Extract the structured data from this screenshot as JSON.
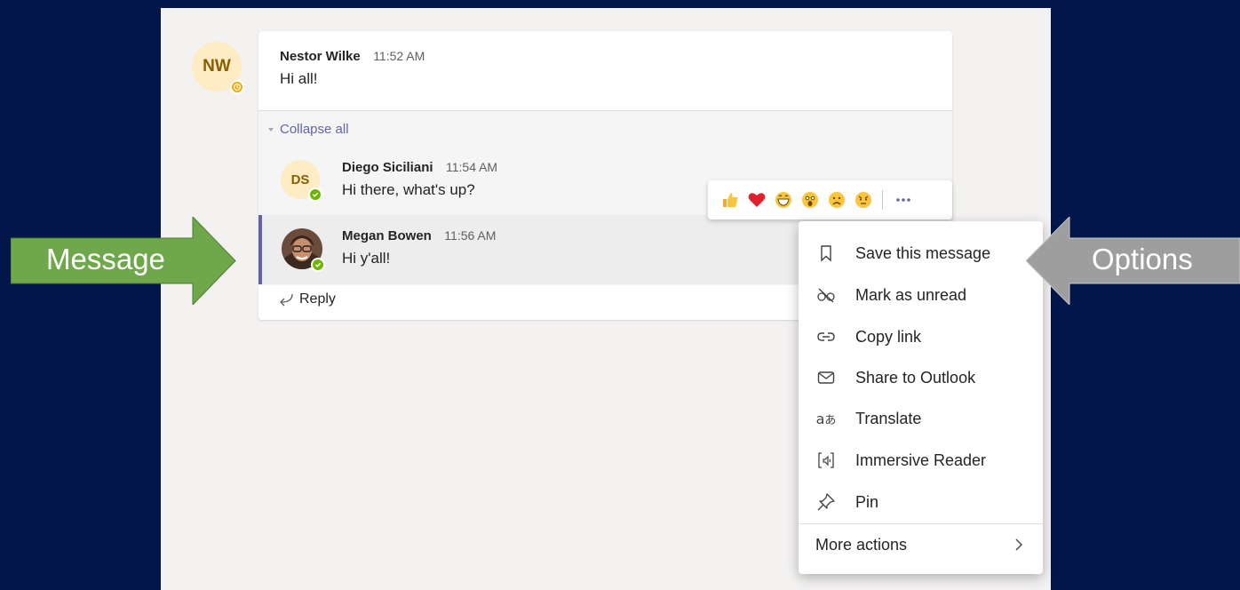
{
  "thread": {
    "root": {
      "avatar_initials": "NW",
      "author": "Nestor Wilke",
      "time": "11:52 AM",
      "text": "Hi all!",
      "status": "away"
    },
    "collapse_label": "Collapse all",
    "replies": [
      {
        "avatar_initials": "DS",
        "author": "Diego Siciliani",
        "time": "11:54 AM",
        "text": "Hi there, what's up?",
        "status": "available"
      },
      {
        "author": "Megan Bowen",
        "time": "11:56 AM",
        "text": "Hi y'all!",
        "status": "available",
        "avatar_type": "photo"
      }
    ],
    "reply_label": "Reply"
  },
  "reactions": [
    "like-icon",
    "heart-icon",
    "laugh-icon",
    "surprised-icon",
    "sad-icon",
    "angry-icon"
  ],
  "more_options_icon": "ellipsis-icon",
  "menu": {
    "items": [
      {
        "label": "Save this message",
        "icon": "bookmark-icon"
      },
      {
        "label": "Mark as unread",
        "icon": "unread-glasses-icon"
      },
      {
        "label": "Copy link",
        "icon": "link-icon"
      },
      {
        "label": "Share to Outlook",
        "icon": "mail-icon"
      },
      {
        "label": "Translate",
        "icon": "translate-icon"
      },
      {
        "label": "Immersive Reader",
        "icon": "immersive-reader-icon"
      },
      {
        "label": "Pin",
        "icon": "pin-icon"
      }
    ],
    "more_actions": "More actions"
  },
  "callouts": {
    "message": "Message",
    "options": "Options"
  },
  "colors": {
    "background": "#02164a",
    "accent": "#6264a7",
    "green_arrow": "#6ea84a",
    "gray_arrow": "#9e9e9e",
    "status_available": "#6bb700",
    "status_away": "#f8a800"
  }
}
